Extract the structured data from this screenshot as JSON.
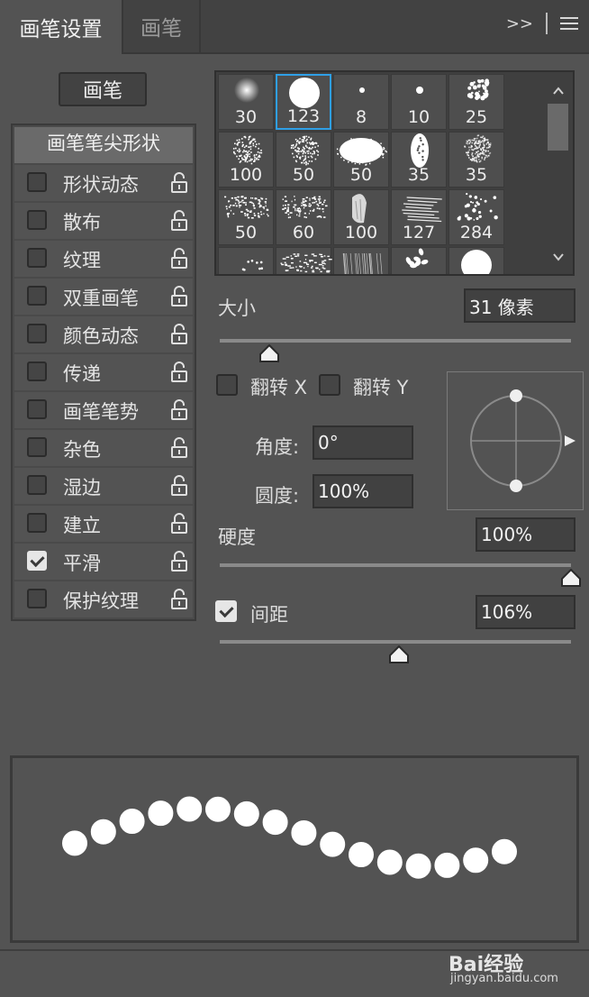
{
  "tabs": [
    {
      "label": "画笔设置",
      "active": true
    },
    {
      "label": "画笔",
      "active": false
    }
  ],
  "tab_controls": {
    "expand_label": ">>"
  },
  "brush_button": "画笔",
  "options": {
    "header": "画笔笔尖形状",
    "items": [
      {
        "label": "形状动态",
        "checked": false
      },
      {
        "label": "散布",
        "checked": false
      },
      {
        "label": "纹理",
        "checked": false
      },
      {
        "label": "双重画笔",
        "checked": false
      },
      {
        "label": "颜色动态",
        "checked": false
      },
      {
        "label": "传递",
        "checked": false
      },
      {
        "label": "画笔笔势",
        "checked": false
      },
      {
        "label": "杂色",
        "checked": false
      },
      {
        "label": "湿边",
        "checked": false
      },
      {
        "label": "建立",
        "checked": false
      },
      {
        "label": "平滑",
        "checked": true
      },
      {
        "label": "保护纹理",
        "checked": false
      }
    ]
  },
  "presets": [
    {
      "size": "30",
      "kind": "soft-round"
    },
    {
      "size": "123",
      "kind": "hard-round",
      "selected": true
    },
    {
      "size": "8",
      "kind": "tiny-dot"
    },
    {
      "size": "10",
      "kind": "small-dot"
    },
    {
      "size": "25",
      "kind": "splatter"
    },
    {
      "size": "100",
      "kind": "chalk-round"
    },
    {
      "size": "50",
      "kind": "chalk-round"
    },
    {
      "size": "50",
      "kind": "spray-ellipse"
    },
    {
      "size": "35",
      "kind": "tall-oval"
    },
    {
      "size": "35",
      "kind": "soft-chalk"
    },
    {
      "size": "50",
      "kind": "dry-brush"
    },
    {
      "size": "60",
      "kind": "dry-brush"
    },
    {
      "size": "100",
      "kind": "bristle"
    },
    {
      "size": "127",
      "kind": "stroke-streaks"
    },
    {
      "size": "284",
      "kind": "scatter-dots"
    },
    {
      "size": "",
      "kind": "sparse-dots"
    },
    {
      "size": "",
      "kind": "rough-stroke"
    },
    {
      "size": "",
      "kind": "fine-hair"
    },
    {
      "size": "",
      "kind": "leaves"
    },
    {
      "size": "",
      "kind": "hard-round"
    }
  ],
  "size": {
    "label": "大小",
    "value": "31 像素",
    "slider_fraction": 0.14
  },
  "flip_x": {
    "label": "翻转 X",
    "checked": false
  },
  "flip_y": {
    "label": "翻转 Y",
    "checked": false
  },
  "angle": {
    "label": "角度:",
    "value": "0°"
  },
  "roundness": {
    "label": "圆度:",
    "value": "100%"
  },
  "hardness": {
    "label": "硬度",
    "value": "100%",
    "slider_fraction": 1.0
  },
  "spacing": {
    "label": "间距",
    "value": "106%",
    "checked": true,
    "slider_fraction": 0.51
  },
  "watermark": {
    "brand": "Bai经验",
    "url": "jingyan.baidu.com"
  },
  "colors": {
    "panel": "#535353",
    "tabbar": "#424242",
    "selection": "#2f9fe6",
    "field": "#414141"
  }
}
